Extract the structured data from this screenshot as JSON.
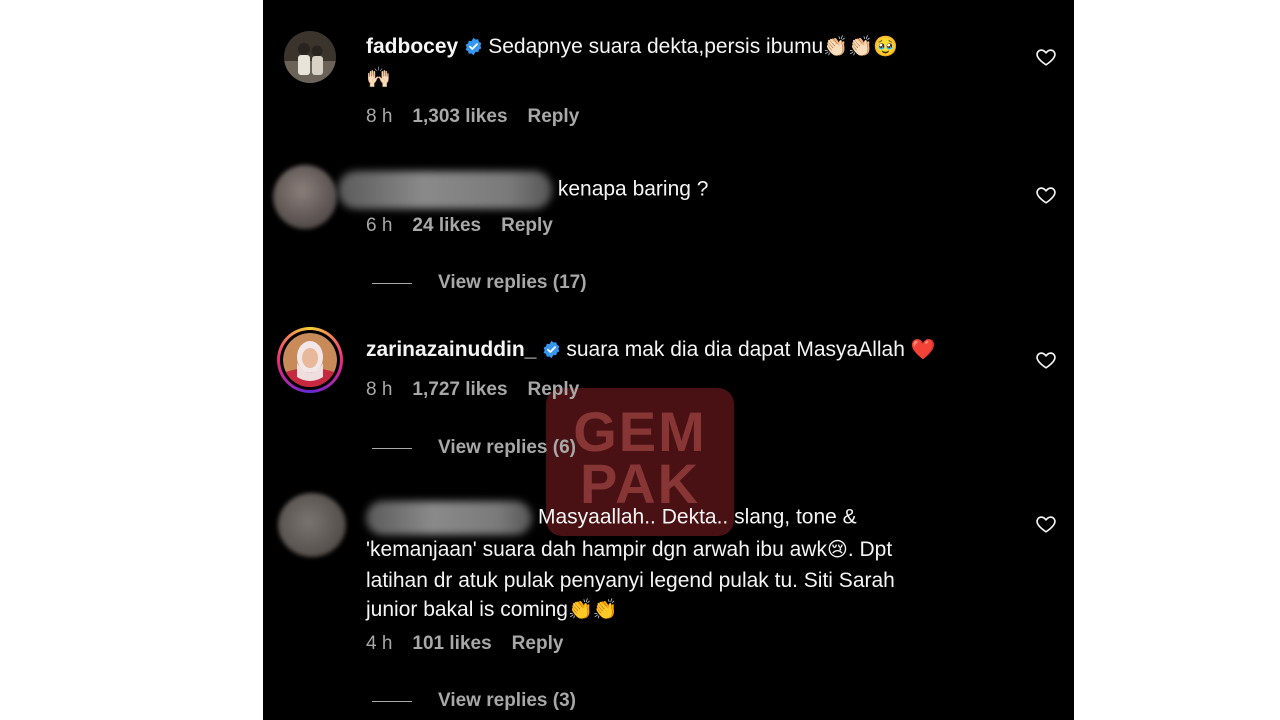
{
  "watermark": {
    "line1": "GEM",
    "line2": "PAK"
  },
  "comments": [
    {
      "username": "fadbocey",
      "verified": true,
      "text": "Sedapnye suara dekta,persis ibumu",
      "emoji_trail": "👏🏻👏🏻🥹",
      "emoji_line2": "🙌🏻",
      "time": "8 h",
      "likes": "1,303 likes",
      "reply": "Reply"
    },
    {
      "username": "",
      "verified": false,
      "text": "kenapa baring ?",
      "time": "6 h",
      "likes": "24 likes",
      "reply": "Reply",
      "view_replies": "View replies (17)"
    },
    {
      "username": "zarinazainuddin_",
      "verified": true,
      "text": "suara mak dia dia dapat MasyaAllah",
      "emoji_trail": "❤️",
      "time": "8 h",
      "likes": "1,727 likes",
      "reply": "Reply",
      "view_replies": "View replies (6)"
    },
    {
      "username": "",
      "verified": false,
      "text_l1": "Masyaallah.. Dekta.. slang, tone &",
      "text_l2": "'kemanjaan' suara dah hampir dgn arwah ibu awk",
      "text_l2_tail": ". Dpt",
      "text_l3": "latihan dr atuk pulak penyanyi legend pulak tu. Siti Sarah",
      "text_l4": "junior bakal is coming",
      "emoji_l2": "😢",
      "emoji_l4": "👏👏",
      "time": "4 h",
      "likes": "101 likes",
      "reply": "Reply",
      "view_replies": "View replies (3)"
    }
  ],
  "colors": {
    "background": "#000000",
    "text": "#f5f5f5",
    "secondary": "#a8a8a8",
    "verified": "#3797f0",
    "story_ring": [
      "#f9ce34",
      "#ee2a7b",
      "#6228d7"
    ]
  },
  "icons": {
    "like": "heart-outline-icon",
    "verified": "verified-badge-icon"
  }
}
